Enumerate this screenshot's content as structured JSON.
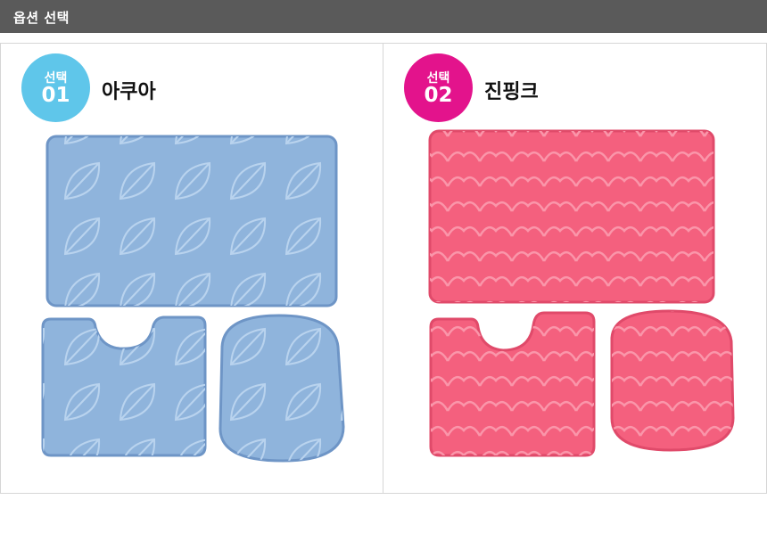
{
  "header": {
    "title": "옵션 선택"
  },
  "options": [
    {
      "badge_label": "선택",
      "number": "01",
      "name": "아쿠아",
      "badge_color": "#5fc6ea",
      "mat_color": "#8fb4dc",
      "mat_edge": "#6e95c6",
      "pattern_color": "#b9d3ee"
    },
    {
      "badge_label": "선택",
      "number": "02",
      "name": "진핑크",
      "badge_color": "#e3138c",
      "mat_color": "#f4607e",
      "mat_edge": "#e04a6a",
      "pattern_color": "#fa96aa"
    }
  ]
}
